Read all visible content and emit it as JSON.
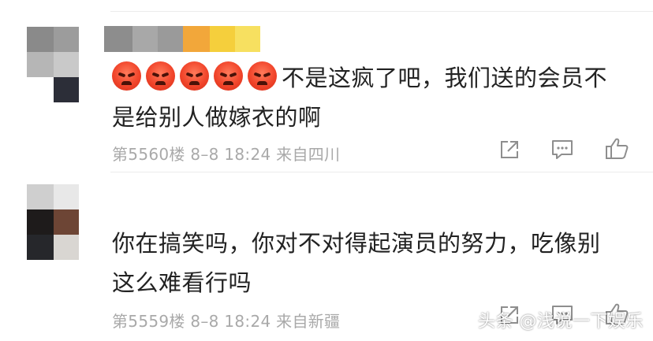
{
  "comments": [
    {
      "text_line1": "不是这疯了吧，我们送的会员不",
      "text_line2": "是给别人做嫁衣的啊",
      "emoji_count": 5,
      "emoji_name": "angry-face-emoji",
      "meta": "第5560楼 8–8 18:24 来自四川"
    },
    {
      "text_line1": "你在搞笑吗，你对不对得起演员的努力，吃像别",
      "text_line2": "这么难看行吗",
      "meta": "第5559楼 8–8 18:24 来自新疆"
    }
  ],
  "icons": {
    "share": "share-icon",
    "comment": "comment-icon",
    "like": "thumbs-up-icon"
  },
  "watermark": "头条 @浅说一下娱乐",
  "colors": {
    "text": "#222222",
    "meta": "#a9a9a9",
    "icon": "#8e8e8e",
    "emoji": "#f1452b"
  }
}
